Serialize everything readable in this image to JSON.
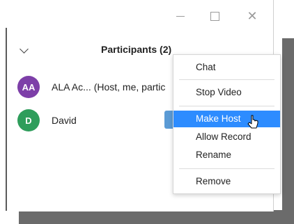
{
  "window": {
    "title": "Participants (2)"
  },
  "participants": [
    {
      "initials": "AA",
      "name": "ALA Ac... (Host, me, partic",
      "avatar_color": "#7d3fa8"
    },
    {
      "initials": "D",
      "name": "David",
      "avatar_color": "#2e9d5b"
    }
  ],
  "context_menu": {
    "items": [
      {
        "label": "Chat"
      },
      {
        "label": "Stop Video"
      },
      {
        "label": "Make Host",
        "highlighted": true
      },
      {
        "label": "Allow Record"
      },
      {
        "label": "Rename"
      },
      {
        "label": "Remove"
      }
    ]
  },
  "colors": {
    "highlight": "#2d8cff",
    "button_blue": "#5b9bd5"
  }
}
